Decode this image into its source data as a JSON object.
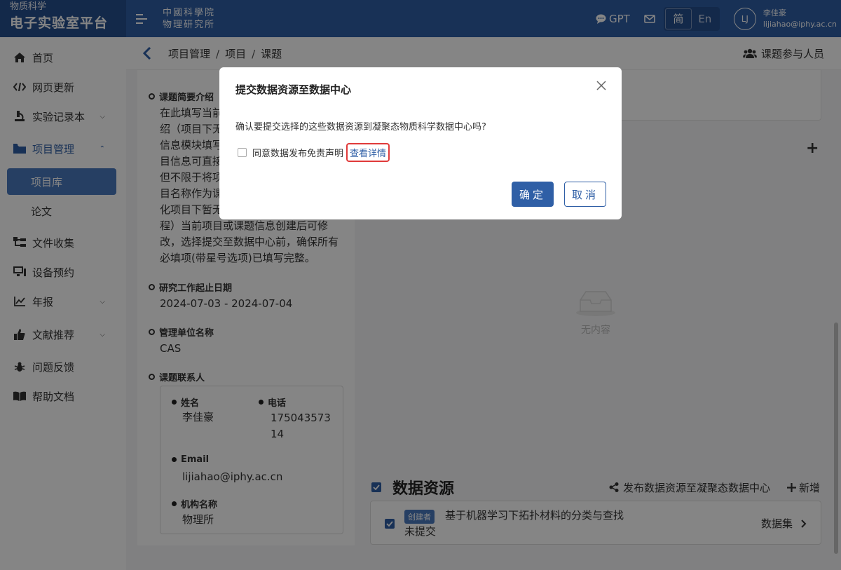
{
  "header": {
    "brand_sub": "物质科学",
    "brand_main": "电子实验室平台",
    "inst_line1": "中國科學院",
    "inst_line2": "物理研究所",
    "gpt_label": "GPT",
    "lang_zh": "简",
    "lang_en": "En",
    "avatar_initials": "LJ",
    "user_name": "李佳豪",
    "user_email": "lijiahao@iphy.ac.cn"
  },
  "sidebar": {
    "items": [
      {
        "label": "首页",
        "icon": "home-icon"
      },
      {
        "label": "网页更新",
        "icon": "code-icon"
      },
      {
        "label": "实验记录本",
        "icon": "flask-icon"
      },
      {
        "label": "项目管理",
        "icon": "folder-icon"
      },
      {
        "label": "项目库"
      },
      {
        "label": "论文"
      },
      {
        "label": "文件收集",
        "icon": "sitemap-icon"
      },
      {
        "label": "设备预约",
        "icon": "desktop-icon"
      },
      {
        "label": "年报",
        "icon": "chart-line-icon"
      },
      {
        "label": "文献推荐",
        "icon": "thumbs-up-icon"
      },
      {
        "label": "问题反馈",
        "icon": "bug-icon"
      },
      {
        "label": "帮助文档",
        "icon": "book-icon"
      }
    ]
  },
  "breadcrumb": {
    "items": [
      "项目管理",
      "项目",
      "课题"
    ],
    "sep": "/",
    "participants": "课题参与人员"
  },
  "detail": {
    "intro_label": "课题简要介绍",
    "intro_lines": [
      "在此填写当前",
      "绍（项目下无",
      "信息模块填写",
      "目信息可直接",
      "但不限于将项",
      "目名称作为课",
      "化项目下暂无",
      "程）当前项目或课题信息创建后可修",
      "改，选择提交至数据中心前，确保所有",
      "必填项(带星号选项)已填写完整。"
    ],
    "date_label": "研究工作起止日期",
    "date_value": "2024-07-03 - 2024-07-04",
    "org_label": "管理单位名称",
    "org_value": "CAS",
    "contact_label": "课题联系人",
    "contact": {
      "name_label": "姓名",
      "name_value": "李佳豪",
      "phone_label": "电话",
      "phone_line1": "175043573",
      "phone_line2": "14",
      "email_label": "Email",
      "email_value": "lijiahao@iphy.ac.cn",
      "inst_label": "机构名称",
      "inst_value": "物理所"
    }
  },
  "empty": {
    "text": "无内容"
  },
  "data_resources": {
    "title": "数据资源",
    "publish_label": "发布数据资源至凝聚态数据中心",
    "add_label": "新增",
    "items": [
      {
        "badge": "创建者",
        "title": "基于机器学习下拓扑材料的分类与查找",
        "status": "未提交",
        "type": "数据集"
      }
    ]
  },
  "modal": {
    "title": "提交数据资源至数据中心",
    "message": "确认要提交选择的这些数据资源到凝聚态物质科学数据中心吗?",
    "agree_label": "同意数据发布免责声明",
    "details_link": "查看详情",
    "ok_label": "确定",
    "cancel_label": "取消"
  },
  "colors": {
    "primary": "#2f5fa6",
    "highlight": "#e03a3a"
  }
}
